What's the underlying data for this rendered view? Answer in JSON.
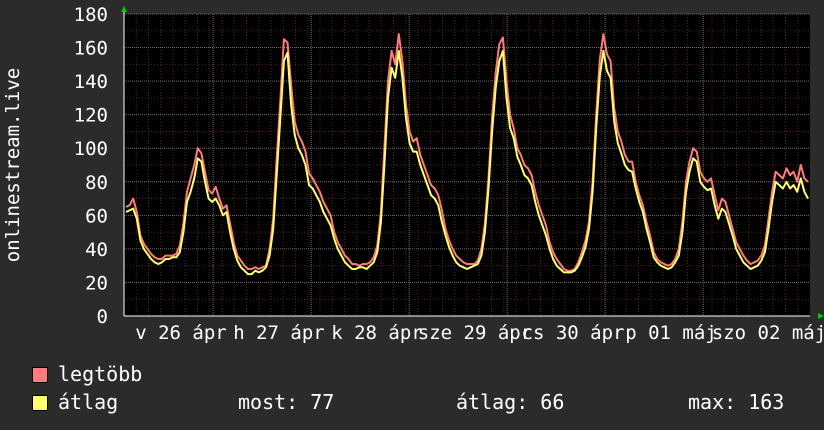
{
  "chart_data": {
    "type": "line",
    "ylabel": "onlinestream.live",
    "ylim": [
      0,
      180
    ],
    "yticks": [
      0,
      20,
      40,
      60,
      80,
      100,
      120,
      140,
      160,
      180
    ],
    "x_tick_labels": [
      "v 26 ápr",
      "h 27 ápr",
      "k 28 ápr",
      "sze 29 ápr",
      "cs 30 ápr",
      "p 01 máj",
      "szo 02 máj"
    ],
    "grid": true,
    "colors": {
      "max": "#ff7b7b",
      "avg": "#ffff70"
    },
    "series": [
      {
        "name": "legtöbb",
        "values": [
          65,
          66,
          70,
          62,
          48,
          43,
          40,
          37,
          35,
          34,
          34,
          36,
          36,
          36,
          37,
          42,
          55,
          74,
          82,
          90,
          100,
          97,
          86,
          75,
          73,
          77,
          70,
          64,
          66,
          55,
          44,
          36,
          33,
          30,
          28,
          28,
          29,
          28,
          29,
          30,
          40,
          58,
          95,
          128,
          165,
          163,
          138,
          116,
          108,
          104,
          98,
          85,
          82,
          78,
          74,
          68,
          64,
          60,
          50,
          44,
          40,
          36,
          34,
          31,
          31,
          30,
          31,
          31,
          32,
          35,
          42,
          62,
          100,
          140,
          158,
          150,
          168,
          152,
          126,
          110,
          104,
          106,
          96,
          90,
          84,
          78,
          76,
          72,
          63,
          52,
          45,
          40,
          36,
          34,
          32,
          31,
          31,
          31,
          33,
          40,
          55,
          82,
          118,
          145,
          162,
          166,
          140,
          120,
          112,
          100,
          96,
          90,
          88,
          84,
          74,
          66,
          60,
          54,
          44,
          38,
          34,
          31,
          28,
          27,
          27,
          28,
          32,
          38,
          45,
          56,
          80,
          120,
          153,
          168,
          156,
          152,
          124,
          110,
          104,
          96,
          92,
          92,
          80,
          72,
          66,
          56,
          48,
          38,
          34,
          32,
          31,
          30,
          31,
          34,
          40,
          56,
          80,
          92,
          100,
          98,
          86,
          82,
          80,
          82,
          72,
          63,
          70,
          68,
          60,
          52,
          44,
          40,
          36,
          33,
          31,
          32,
          33,
          36,
          42,
          58,
          74,
          86,
          84,
          82,
          88,
          84,
          86,
          80,
          90,
          82,
          80
        ]
      },
      {
        "name": "átlag",
        "values": [
          62,
          63,
          64,
          58,
          45,
          40,
          37,
          34,
          32,
          31,
          32,
          34,
          34,
          35,
          35,
          38,
          50,
          68,
          74,
          82,
          94,
          92,
          80,
          70,
          68,
          70,
          66,
          60,
          62,
          50,
          40,
          33,
          29,
          27,
          25,
          25,
          27,
          26,
          27,
          29,
          36,
          52,
          85,
          118,
          152,
          157,
          126,
          108,
          100,
          96,
          90,
          78,
          76,
          72,
          68,
          62,
          58,
          54,
          46,
          40,
          36,
          32,
          30,
          28,
          28,
          29,
          29,
          28,
          30,
          32,
          38,
          56,
          90,
          130,
          148,
          142,
          158,
          142,
          118,
          103,
          98,
          98,
          90,
          84,
          78,
          72,
          70,
          66,
          56,
          48,
          41,
          36,
          32,
          30,
          29,
          28,
          29,
          30,
          31,
          36,
          50,
          76,
          110,
          136,
          152,
          158,
          130,
          112,
          106,
          95,
          90,
          84,
          82,
          78,
          68,
          60,
          54,
          48,
          40,
          34,
          30,
          28,
          26,
          26,
          26,
          27,
          30,
          35,
          41,
          52,
          74,
          112,
          143,
          158,
          146,
          142,
          116,
          103,
          97,
          90,
          87,
          86,
          76,
          68,
          62,
          52,
          44,
          35,
          32,
          30,
          29,
          28,
          29,
          32,
          36,
          50,
          74,
          86,
          94,
          92,
          80,
          77,
          75,
          76,
          66,
          58,
          64,
          62,
          55,
          48,
          40,
          36,
          32,
          30,
          28,
          29,
          30,
          33,
          38,
          52,
          68,
          80,
          78,
          76,
          80,
          76,
          78,
          74,
          82,
          74,
          70
        ]
      }
    ]
  },
  "legend": {
    "max_label": "legtöbb",
    "avg_label": "átlag"
  },
  "stats": {
    "most": "most: 77",
    "atlag": "átlag: 66",
    "max": "max: 163"
  }
}
